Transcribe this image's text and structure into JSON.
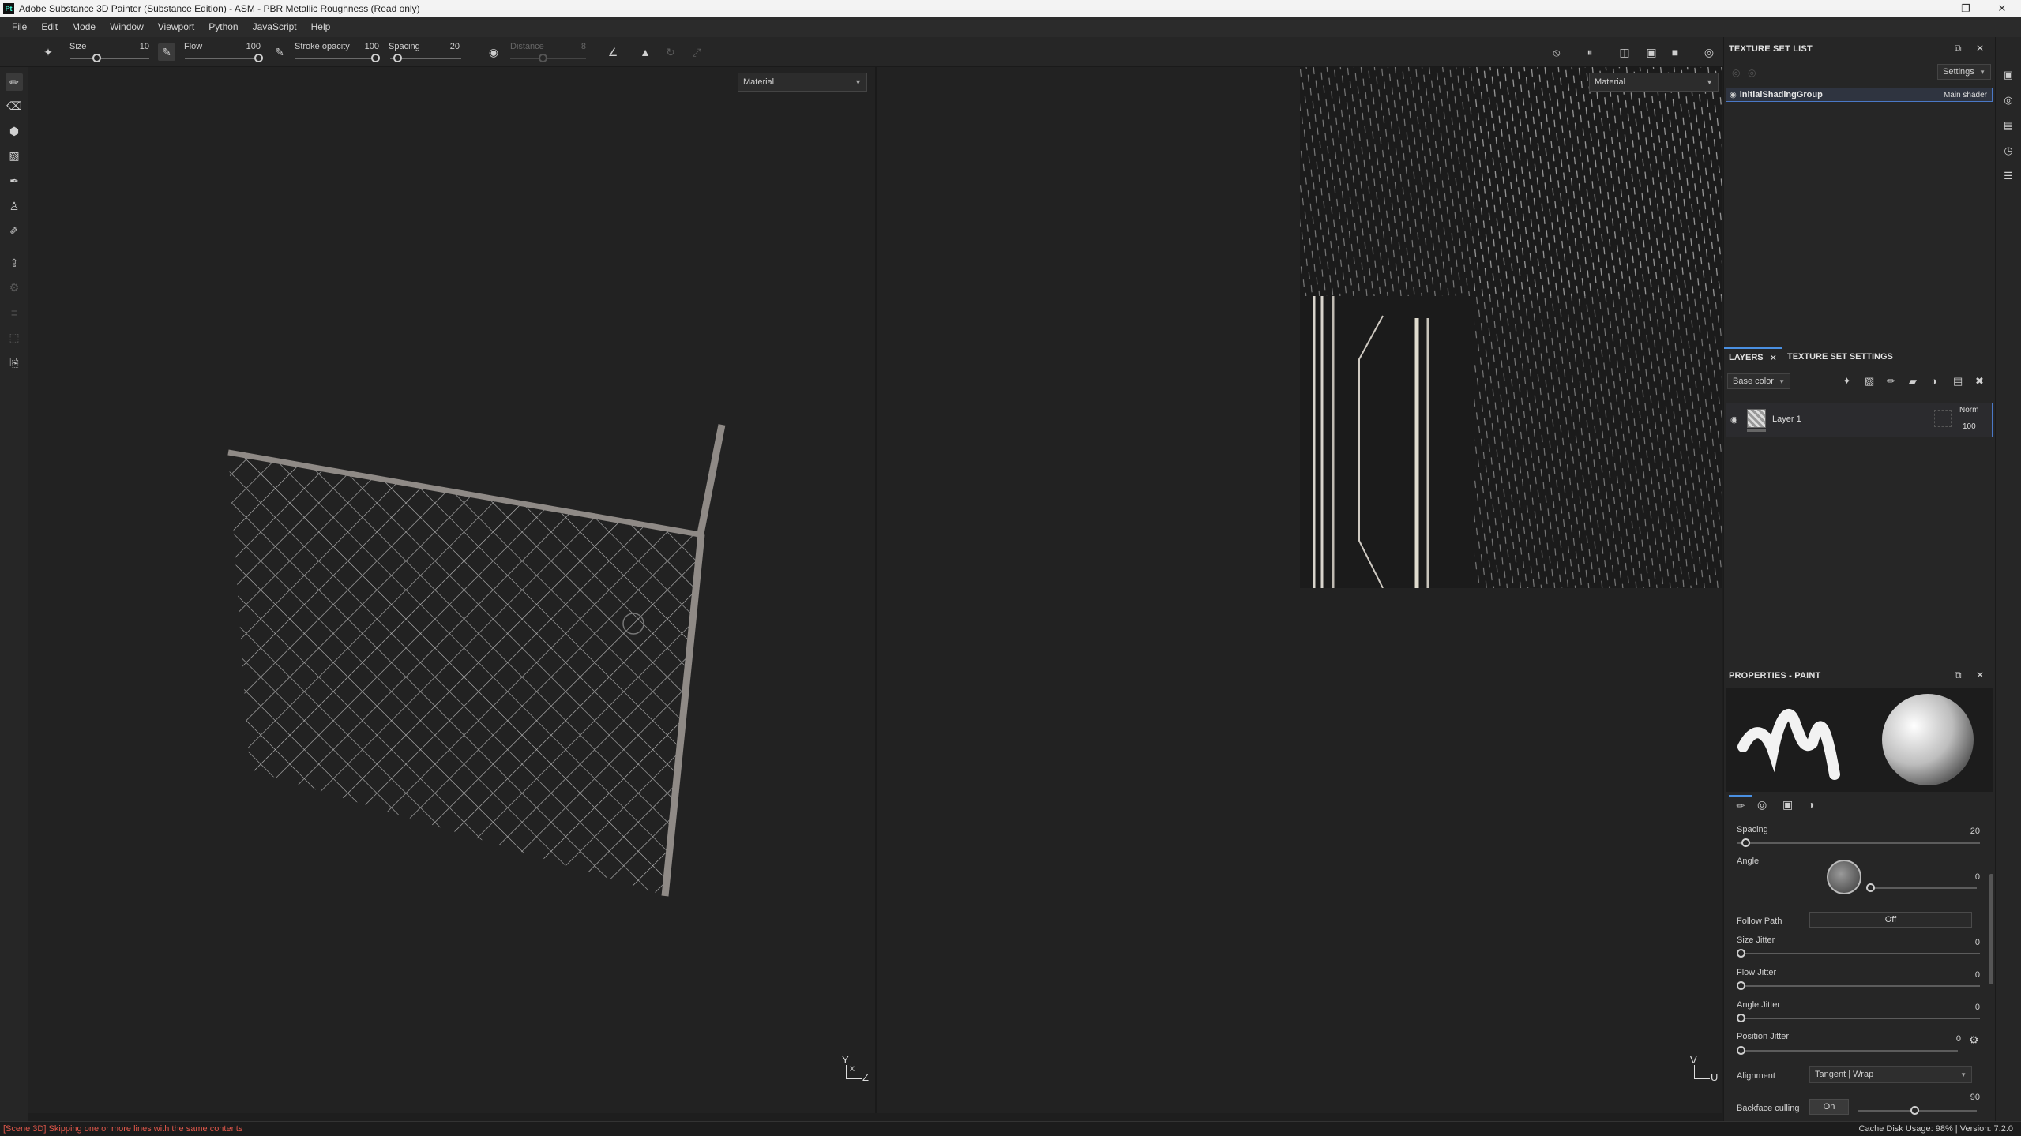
{
  "window": {
    "title": "Adobe Substance 3D Painter (Substance Edition) - ASM - PBR Metallic Roughness (Read only)",
    "logo": "Pt",
    "controls": [
      "minimize-icon",
      "maximize-icon",
      "close-icon"
    ]
  },
  "menu": [
    "File",
    "Edit",
    "Mode",
    "Window",
    "Viewport",
    "Python",
    "JavaScript",
    "Help"
  ],
  "toolbar": {
    "size_label": "Size",
    "size_value": "10",
    "flow_label": "Flow",
    "flow_value": "100",
    "stroke_opacity_label": "Stroke opacity",
    "stroke_opacity_value": "100",
    "spacing_label": "Spacing",
    "spacing_value": "20",
    "distance_label": "Distance",
    "distance_value": "8"
  },
  "viewport": {
    "left_mode": "Material",
    "right_mode": "Material",
    "axis_3d": [
      "Y",
      "X",
      "Z"
    ],
    "axis_2d": [
      "V",
      "U"
    ]
  },
  "texture_set_list": {
    "title": "TEXTURE SET LIST",
    "settings_label": "Settings",
    "item_name": "initialShadingGroup",
    "item_shader": "Main shader"
  },
  "layers": {
    "tab_layers": "LAYERS",
    "tab_settings": "TEXTURE SET SETTINGS",
    "channel": "Base color",
    "layer_name": "Layer 1",
    "blend_mode": "Norm",
    "opacity": "100"
  },
  "properties": {
    "title": "PROPERTIES - PAINT",
    "spacing_label": "Spacing",
    "spacing_value": "20",
    "spacing_level": 0.2,
    "angle_label": "Angle",
    "angle_value": "0",
    "follow_path_label": "Follow Path",
    "follow_path_value": "Off",
    "size_jitter_label": "Size Jitter",
    "size_jitter_value": "0",
    "flow_jitter_label": "Flow Jitter",
    "flow_jitter_value": "0",
    "angle_jitter_label": "Angle Jitter",
    "angle_jitter_value": "0",
    "position_jitter_label": "Position Jitter",
    "position_jitter_value": "0",
    "alignment_label": "Alignment",
    "alignment_value": "Tangent | Wrap",
    "backface_label": "Backface culling",
    "backface_value": "On",
    "backface_angle": "90"
  },
  "status": {
    "message": "[Scene 3D] Skipping one or more lines with the same contents",
    "right": "Cache Disk Usage:   98% | Version: 7.2.0"
  },
  "colors": {
    "accent": "#4a90e2",
    "error": "#e0574a"
  }
}
